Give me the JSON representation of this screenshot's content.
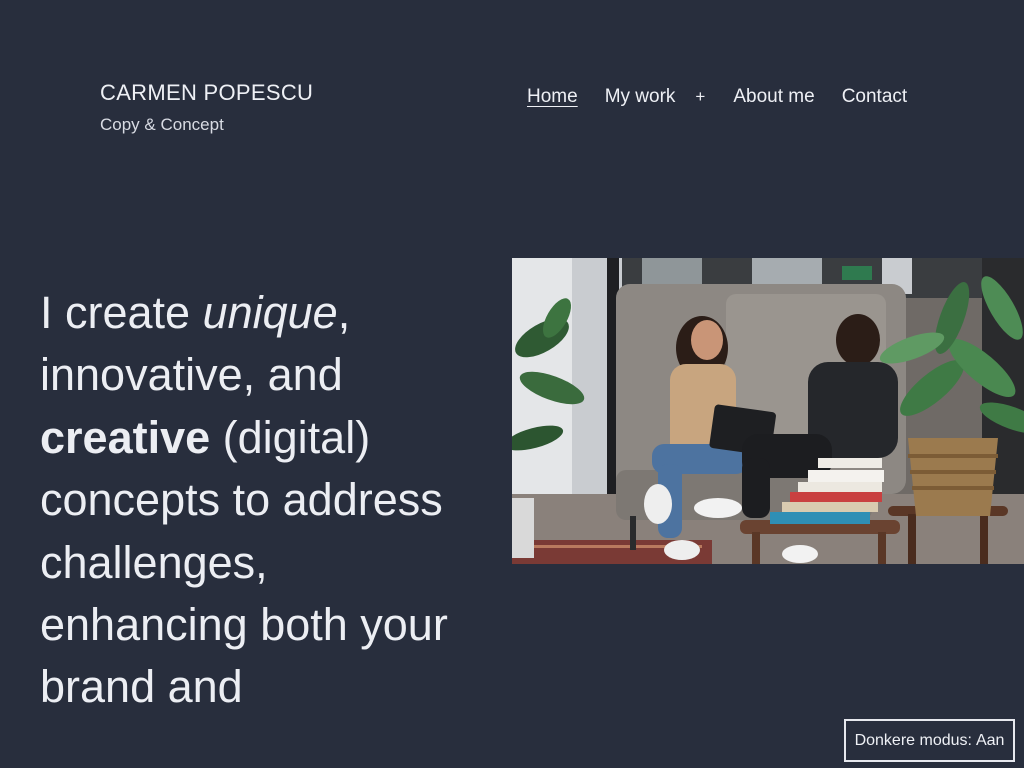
{
  "site": {
    "title": "CARMEN POPESCU",
    "tagline": "Copy & Concept"
  },
  "nav": {
    "items": [
      {
        "label": "Home",
        "active": true
      },
      {
        "label": "My work",
        "active": false
      },
      {
        "label": "+",
        "active": false
      },
      {
        "label": "About me",
        "active": false
      },
      {
        "label": "Contact",
        "active": false
      }
    ]
  },
  "hero": {
    "t1": "I create ",
    "t2": "unique",
    "t3": ", innovative, and ",
    "t4": "creative",
    "t5": " (digital) concepts to address challenges, enhancing both your brand and"
  },
  "image": {
    "alt": "Two women talking on a sofa in an office lounge"
  },
  "dark_mode": {
    "label": "Donkere modus:",
    "state": "Aan"
  },
  "colors": {
    "background": "#282e3d",
    "text": "#eceef3"
  }
}
